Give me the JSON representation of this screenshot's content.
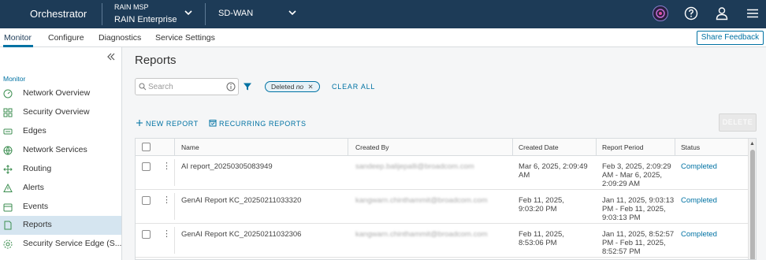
{
  "header": {
    "brand": "Orchestrator",
    "msp_label": "RAIN MSP",
    "enterprise_label": "RAIN Enterprise",
    "product_label": "SD-WAN"
  },
  "nav": {
    "tabs": [
      {
        "label": "Monitor",
        "active": true
      },
      {
        "label": "Configure",
        "active": false
      },
      {
        "label": "Diagnostics",
        "active": false
      },
      {
        "label": "Service Settings",
        "active": false
      }
    ],
    "share_feedback": "Share Feedback"
  },
  "sidebar": {
    "section_label": "Monitor",
    "items": [
      {
        "label": "Network Overview",
        "icon": "gauge-icon"
      },
      {
        "label": "Security Overview",
        "icon": "grid-icon"
      },
      {
        "label": "Edges",
        "icon": "edge-icon"
      },
      {
        "label": "Network Services",
        "icon": "network-services-icon"
      },
      {
        "label": "Routing",
        "icon": "routing-icon"
      },
      {
        "label": "Alerts",
        "icon": "alert-icon"
      },
      {
        "label": "Events",
        "icon": "events-icon"
      },
      {
        "label": "Reports",
        "icon": "report-icon",
        "selected": true
      },
      {
        "label": "Security Service Edge (S...",
        "icon": "sse-icon"
      }
    ]
  },
  "main": {
    "title": "Reports",
    "search_placeholder": "Search",
    "filter_chip": {
      "key": "Deleted",
      "value": "no"
    },
    "clear_all": "CLEAR ALL",
    "new_report": "NEW REPORT",
    "recurring_reports": "RECURRING REPORTS",
    "delete": "DELETE",
    "accent_color": "#0072a3",
    "table": {
      "headers": [
        "Name",
        "Created By",
        "Created Date",
        "Report Period",
        "Status"
      ],
      "rows": [
        {
          "name": "AI report_20250305083949",
          "created_by": "sandeep.balijepalli@broadcom.com",
          "created_date": "Mar 6, 2025, 2:09:49 AM",
          "report_period": "Feb 3, 2025, 2:09:29 AM - Mar 6, 2025, 2:09:29 AM",
          "status": "Completed"
        },
        {
          "name": "GenAI Report KC_20250211033320",
          "created_by": "kangwarn.chinthammit@broadcom.com",
          "created_date": "Feb 11, 2025, 9:03:20 PM",
          "report_period": "Jan 11, 2025, 9:03:13 PM - Feb 11, 2025, 9:03:13 PM",
          "status": "Completed"
        },
        {
          "name": "GenAI Report KC_20250211032306",
          "created_by": "kangwarn.chinthammit@broadcom.com",
          "created_date": "Feb 11, 2025, 8:53:06 PM",
          "report_period": "Jan 11, 2025, 8:52:57 PM - Feb 11, 2025, 8:52:57 PM",
          "status": "Completed"
        }
      ]
    }
  }
}
